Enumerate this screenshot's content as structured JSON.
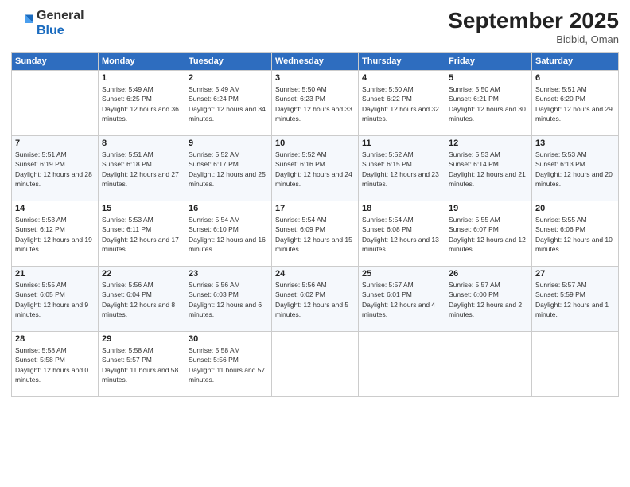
{
  "logo": {
    "general": "General",
    "blue": "Blue"
  },
  "title": "September 2025",
  "location": "Bidbid, Oman",
  "days_header": [
    "Sunday",
    "Monday",
    "Tuesday",
    "Wednesday",
    "Thursday",
    "Friday",
    "Saturday"
  ],
  "weeks": [
    [
      {
        "num": "",
        "sunrise": "",
        "sunset": "",
        "daylight": ""
      },
      {
        "num": "1",
        "sunrise": "Sunrise: 5:49 AM",
        "sunset": "Sunset: 6:25 PM",
        "daylight": "Daylight: 12 hours and 36 minutes."
      },
      {
        "num": "2",
        "sunrise": "Sunrise: 5:49 AM",
        "sunset": "Sunset: 6:24 PM",
        "daylight": "Daylight: 12 hours and 34 minutes."
      },
      {
        "num": "3",
        "sunrise": "Sunrise: 5:50 AM",
        "sunset": "Sunset: 6:23 PM",
        "daylight": "Daylight: 12 hours and 33 minutes."
      },
      {
        "num": "4",
        "sunrise": "Sunrise: 5:50 AM",
        "sunset": "Sunset: 6:22 PM",
        "daylight": "Daylight: 12 hours and 32 minutes."
      },
      {
        "num": "5",
        "sunrise": "Sunrise: 5:50 AM",
        "sunset": "Sunset: 6:21 PM",
        "daylight": "Daylight: 12 hours and 30 minutes."
      },
      {
        "num": "6",
        "sunrise": "Sunrise: 5:51 AM",
        "sunset": "Sunset: 6:20 PM",
        "daylight": "Daylight: 12 hours and 29 minutes."
      }
    ],
    [
      {
        "num": "7",
        "sunrise": "Sunrise: 5:51 AM",
        "sunset": "Sunset: 6:19 PM",
        "daylight": "Daylight: 12 hours and 28 minutes."
      },
      {
        "num": "8",
        "sunrise": "Sunrise: 5:51 AM",
        "sunset": "Sunset: 6:18 PM",
        "daylight": "Daylight: 12 hours and 27 minutes."
      },
      {
        "num": "9",
        "sunrise": "Sunrise: 5:52 AM",
        "sunset": "Sunset: 6:17 PM",
        "daylight": "Daylight: 12 hours and 25 minutes."
      },
      {
        "num": "10",
        "sunrise": "Sunrise: 5:52 AM",
        "sunset": "Sunset: 6:16 PM",
        "daylight": "Daylight: 12 hours and 24 minutes."
      },
      {
        "num": "11",
        "sunrise": "Sunrise: 5:52 AM",
        "sunset": "Sunset: 6:15 PM",
        "daylight": "Daylight: 12 hours and 23 minutes."
      },
      {
        "num": "12",
        "sunrise": "Sunrise: 5:53 AM",
        "sunset": "Sunset: 6:14 PM",
        "daylight": "Daylight: 12 hours and 21 minutes."
      },
      {
        "num": "13",
        "sunrise": "Sunrise: 5:53 AM",
        "sunset": "Sunset: 6:13 PM",
        "daylight": "Daylight: 12 hours and 20 minutes."
      }
    ],
    [
      {
        "num": "14",
        "sunrise": "Sunrise: 5:53 AM",
        "sunset": "Sunset: 6:12 PM",
        "daylight": "Daylight: 12 hours and 19 minutes."
      },
      {
        "num": "15",
        "sunrise": "Sunrise: 5:53 AM",
        "sunset": "Sunset: 6:11 PM",
        "daylight": "Daylight: 12 hours and 17 minutes."
      },
      {
        "num": "16",
        "sunrise": "Sunrise: 5:54 AM",
        "sunset": "Sunset: 6:10 PM",
        "daylight": "Daylight: 12 hours and 16 minutes."
      },
      {
        "num": "17",
        "sunrise": "Sunrise: 5:54 AM",
        "sunset": "Sunset: 6:09 PM",
        "daylight": "Daylight: 12 hours and 15 minutes."
      },
      {
        "num": "18",
        "sunrise": "Sunrise: 5:54 AM",
        "sunset": "Sunset: 6:08 PM",
        "daylight": "Daylight: 12 hours and 13 minutes."
      },
      {
        "num": "19",
        "sunrise": "Sunrise: 5:55 AM",
        "sunset": "Sunset: 6:07 PM",
        "daylight": "Daylight: 12 hours and 12 minutes."
      },
      {
        "num": "20",
        "sunrise": "Sunrise: 5:55 AM",
        "sunset": "Sunset: 6:06 PM",
        "daylight": "Daylight: 12 hours and 10 minutes."
      }
    ],
    [
      {
        "num": "21",
        "sunrise": "Sunrise: 5:55 AM",
        "sunset": "Sunset: 6:05 PM",
        "daylight": "Daylight: 12 hours and 9 minutes."
      },
      {
        "num": "22",
        "sunrise": "Sunrise: 5:56 AM",
        "sunset": "Sunset: 6:04 PM",
        "daylight": "Daylight: 12 hours and 8 minutes."
      },
      {
        "num": "23",
        "sunrise": "Sunrise: 5:56 AM",
        "sunset": "Sunset: 6:03 PM",
        "daylight": "Daylight: 12 hours and 6 minutes."
      },
      {
        "num": "24",
        "sunrise": "Sunrise: 5:56 AM",
        "sunset": "Sunset: 6:02 PM",
        "daylight": "Daylight: 12 hours and 5 minutes."
      },
      {
        "num": "25",
        "sunrise": "Sunrise: 5:57 AM",
        "sunset": "Sunset: 6:01 PM",
        "daylight": "Daylight: 12 hours and 4 minutes."
      },
      {
        "num": "26",
        "sunrise": "Sunrise: 5:57 AM",
        "sunset": "Sunset: 6:00 PM",
        "daylight": "Daylight: 12 hours and 2 minutes."
      },
      {
        "num": "27",
        "sunrise": "Sunrise: 5:57 AM",
        "sunset": "Sunset: 5:59 PM",
        "daylight": "Daylight: 12 hours and 1 minute."
      }
    ],
    [
      {
        "num": "28",
        "sunrise": "Sunrise: 5:58 AM",
        "sunset": "Sunset: 5:58 PM",
        "daylight": "Daylight: 12 hours and 0 minutes."
      },
      {
        "num": "29",
        "sunrise": "Sunrise: 5:58 AM",
        "sunset": "Sunset: 5:57 PM",
        "daylight": "Daylight: 11 hours and 58 minutes."
      },
      {
        "num": "30",
        "sunrise": "Sunrise: 5:58 AM",
        "sunset": "Sunset: 5:56 PM",
        "daylight": "Daylight: 11 hours and 57 minutes."
      },
      {
        "num": "",
        "sunrise": "",
        "sunset": "",
        "daylight": ""
      },
      {
        "num": "",
        "sunrise": "",
        "sunset": "",
        "daylight": ""
      },
      {
        "num": "",
        "sunrise": "",
        "sunset": "",
        "daylight": ""
      },
      {
        "num": "",
        "sunrise": "",
        "sunset": "",
        "daylight": ""
      }
    ]
  ]
}
